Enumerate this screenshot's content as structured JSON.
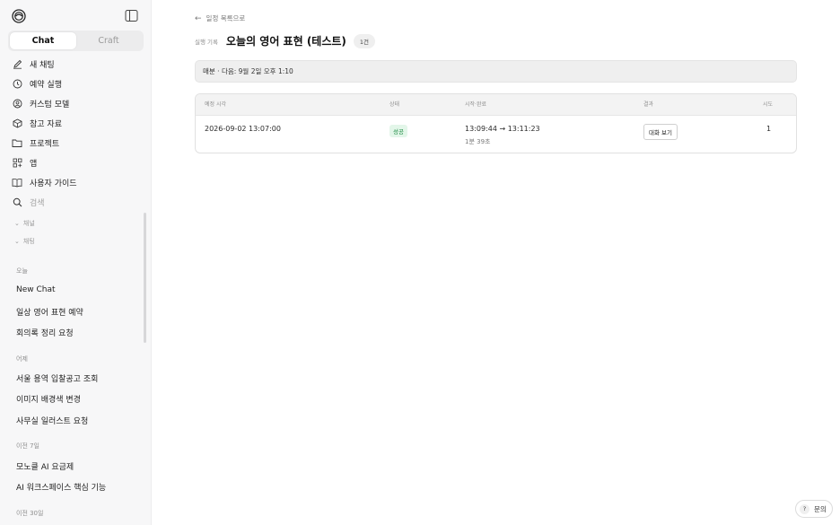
{
  "sidebar": {
    "tabs": {
      "chat": "Chat",
      "craft": "Craft"
    },
    "nav": [
      {
        "label": "새 채팅",
        "icon": "edit-icon"
      },
      {
        "label": "예약 실행",
        "icon": "clock-icon"
      },
      {
        "label": "커스텀 모델",
        "icon": "custom-model-icon"
      },
      {
        "label": "참고 자료",
        "icon": "box-icon"
      },
      {
        "label": "프로젝트",
        "icon": "folder-icon"
      },
      {
        "label": "앱",
        "icon": "apps-icon"
      },
      {
        "label": "사용자 가이드",
        "icon": "book-icon"
      },
      {
        "label": "검색",
        "icon": "search-icon"
      }
    ],
    "sections": {
      "channels": "채널",
      "chats": "채팅"
    },
    "groups": [
      {
        "label": "오늘",
        "items": [
          "New Chat",
          "일상 영어 표현 예약",
          "회의록 정리 요청"
        ]
      },
      {
        "label": "어제",
        "items": [
          "서울 용역 입찰공고 조회",
          "이미지 배경색 변경",
          "사무실 일러스트 요청"
        ]
      },
      {
        "label": "이전 7일",
        "items": [
          "모노클 AI 요금제",
          "AI 워크스페이스 핵심 기능"
        ]
      },
      {
        "label": "이전 30일",
        "items": []
      }
    ]
  },
  "main": {
    "back_label": "일정 목록으로",
    "eyebrow": "실행 기록",
    "title": "오늘의 영어 표현 (테스트)",
    "count": "1건",
    "schedule_text": "매분 · 다음: 9월 2일 오후 1:10",
    "table": {
      "headers": [
        "예정 시각",
        "상태",
        "시작·완료",
        "결과",
        "시도"
      ],
      "rows": [
        {
          "scheduled": "2026-09-02 13:07:00",
          "status": "성공",
          "time_range": "13:09:44 → 13:11:23",
          "duration": "1분 39초",
          "result_button": "대화 보기",
          "attempts": "1"
        }
      ]
    }
  },
  "help": {
    "label": "문의",
    "icon_glyph": "?"
  }
}
